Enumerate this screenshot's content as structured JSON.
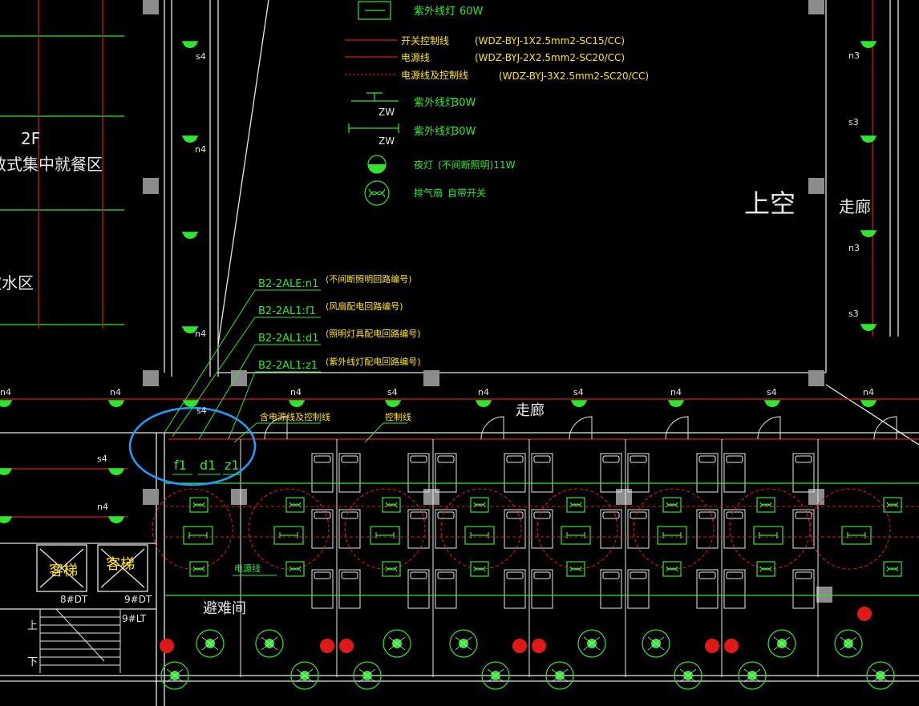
{
  "colors": {
    "background": "#000000",
    "wall": "#e8e8e8",
    "column": "#8c8c8c",
    "circuit_red": "#e01818",
    "fixture_green": "#2ee62e",
    "text_yellow": "#ffe600",
    "highlight_blue": "#1aa0ff"
  },
  "legend": [
    {
      "icon": "uv-lamp-box-icon",
      "label": "紫外线灯",
      "spec": "60W"
    },
    {
      "icon": "switch-control-line-icon",
      "label": "开关控制线",
      "spec": "(WDZ-BYJ-1X2.5mm2-SC15/CC)"
    },
    {
      "icon": "power-line-icon",
      "label": "电源线",
      "spec": "(WDZ-BYJ-2X2.5mm2-SC20/CC)"
    },
    {
      "icon": "power-control-line-icon",
      "label": "电源线及控制线",
      "spec": "(WDZ-BYJ-3X2.5mm2-SC20/CC)"
    },
    {
      "icon": "uv-lamp-wall-icon",
      "label": "紫外线灯",
      "spec": "30W",
      "tag": "ZW"
    },
    {
      "icon": "uv-lamp-ceiling-icon",
      "label": "紫外线灯",
      "spec": "30W",
      "tag": "ZW"
    },
    {
      "icon": "night-lamp-icon",
      "label": "夜灯",
      "spec": "(不间断照明)11W"
    },
    {
      "icon": "exhaust-fan-icon",
      "label": "排气扇",
      "spec": "自带开关"
    }
  ],
  "rooms": {
    "floor": "2F",
    "dining": "散式集中就餐区",
    "water": "饮水区",
    "void": "上空",
    "corridor_right": "走廊",
    "corridor_main": "走廊",
    "refuge": "避难间",
    "elevator1": "客梯",
    "elevator2": "客梯",
    "elevator1_tag": "8#DT",
    "elevator2_tag": "9#DT",
    "elevator3_tag": "9#LT",
    "stair_up": "上",
    "stair_down": "下"
  },
  "circuit_callouts": [
    {
      "code": "B2-2ALE:n1",
      "note": "(不间断照明回路编号)"
    },
    {
      "code": "B2-2AL1:f1",
      "note": "(风扇配电回路编号)"
    },
    {
      "code": "B2-2AL1:d1",
      "note": "(照明灯具配电回路编号)"
    },
    {
      "code": "B2-2AL1:z1",
      "note": "(紫外线灯配电回路编号)"
    }
  ],
  "highlight_labels": [
    "f1",
    "d1",
    "z1"
  ],
  "wire_notes": {
    "power_and_control": "含电源线及控制线",
    "control": "控制线",
    "power": "电源线"
  },
  "fixture_tags": {
    "left_column": [
      "s4",
      "n4",
      "n4"
    ],
    "corridor": [
      "n4",
      "n4",
      "n4",
      "s4",
      "n4",
      "s4",
      "n4",
      "s4",
      "n4"
    ],
    "left_side": [
      "s4",
      "n4"
    ],
    "right_column": [
      "n3",
      "s3",
      "n3",
      "s3"
    ],
    "lobby": "s4"
  }
}
